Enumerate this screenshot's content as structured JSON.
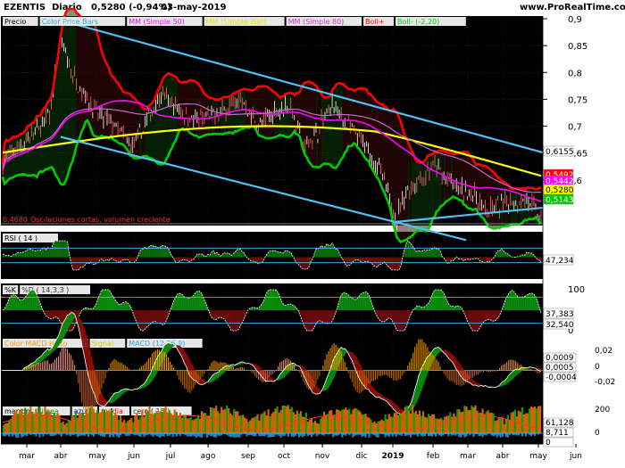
{
  "header": {
    "symbol": "EZENTIS",
    "period": "Diario",
    "price_change": "0,5280 (-0,94%)",
    "date": "03-may-2019",
    "site": "www.ProRealTime.com"
  },
  "price_panel": {
    "legend": [
      {
        "label": "Precio",
        "color": "#000000"
      },
      {
        "label": "Color Price Bars",
        "color": "#2ea8e0"
      },
      {
        "label": "MM (Simple 50)",
        "color": "#ff00ff"
      },
      {
        "label": "MM (Simple 200)",
        "color": "#e6e600"
      },
      {
        "label": "MM (Simple 80)",
        "color": "#cc33cc"
      },
      {
        "label": "Boll+",
        "color": "#ff0000"
      },
      {
        "label": "Boll- (-2,20)",
        "color": "#00cc00"
      }
    ],
    "y_ticks": [
      "0,9",
      "0,85",
      "0,8",
      "0,75",
      "0,7",
      "0,65",
      "0,6"
    ],
    "y_range": [
      0.515,
      0.905
    ],
    "value_boxes": [
      {
        "value": "0,6155",
        "bg": "#ffffff",
        "fg": "#000000",
        "v": 0.6155
      },
      {
        "value": "0,5492",
        "bg": "#ff0000",
        "fg": "#ffffff",
        "v": 0.5492
      },
      {
        "value": "0,5442",
        "bg": "#ff00ff",
        "fg": "#ffffff",
        "v": 0.5442
      },
      {
        "value": "0,5280",
        "bg": "#ffff00",
        "fg": "#000000",
        "v": 0.528
      },
      {
        "value": "0,5143",
        "bg": "#00cc00",
        "fg": "#ffffff",
        "v": 0.5143
      }
    ],
    "bottom_note": "0,4680",
    "bottom_caption": "Oscilaciones cortas, volumen creciente"
  },
  "rsi_panel": {
    "legend": [
      {
        "label": "RSI ( 14 )",
        "color": "#000000"
      }
    ],
    "value_box": {
      "value": "47,234",
      "bg": "#ffffff",
      "fg": "#000000"
    }
  },
  "stoch_panel": {
    "legend": [
      {
        "label": "%K",
        "color": "#000000"
      },
      {
        "label": "%D ( 14,3,3 )",
        "color": "#333333"
      }
    ],
    "y_ticks": [
      "100",
      "0"
    ],
    "value_boxes": [
      {
        "value": "37,383",
        "bg": "#ffffff",
        "fg": "#000000"
      },
      {
        "value": "32,540",
        "bg": "#ffffff",
        "fg": "#000000"
      }
    ]
  },
  "macd_panel": {
    "legend": [
      {
        "label": "Color MACD Histo",
        "color": "#ff9900"
      },
      {
        "label": "Signal",
        "color": "#cccc00"
      },
      {
        "label": "MACD (12,26,9)",
        "color": "#2ea8e0"
      }
    ],
    "y_ticks": [
      "0,02",
      "0",
      "-0,02"
    ],
    "value_boxes": [
      {
        "value": "0,0009",
        "bg": "#ffffff",
        "fg": "#000000"
      },
      {
        "value": "0,0005",
        "bg": "#ffffff",
        "fg": "#000000"
      },
      {
        "value": "-0,0004",
        "bg": "#ffffff",
        "fg": "#000000"
      }
    ]
  },
  "vol_panel": {
    "legend": [
      {
        "label": "marron",
        "color": "#000000"
      },
      {
        "label": "linea",
        "color": "#00aa00"
      },
      {
        "label": "azul",
        "color": "#0000cc"
      },
      {
        "label": "media",
        "color": "#ff0000"
      },
      {
        "label": "cero ( 15 )",
        "color": "#333333"
      }
    ],
    "y_ticks": [
      "200",
      "0"
    ],
    "value_boxes": [
      {
        "value": "61,128",
        "bg": "#ffffff",
        "fg": "#000000"
      },
      {
        "value": "8,711",
        "bg": "#ffffff",
        "fg": "#000000"
      },
      {
        "value": "0",
        "bg": "#ffffff",
        "fg": "#000000"
      }
    ]
  },
  "x_axis": {
    "months": [
      "mar",
      "abr",
      "may",
      "jun",
      "jul",
      "ago",
      "sep",
      "oct",
      "nov",
      "dic",
      "2019",
      "feb",
      "mar",
      "abr",
      "may",
      "jun"
    ]
  },
  "chart_data": {
    "type": "line",
    "x_labels": [
      "mar",
      "abr",
      "may",
      "jun",
      "jul",
      "ago",
      "sep",
      "oct",
      "nov",
      "dic",
      "2019",
      "feb",
      "mar",
      "abr",
      "may"
    ],
    "series": [
      {
        "name": "Precio",
        "values": [
          0.64,
          0.84,
          0.73,
          0.66,
          0.74,
          0.71,
          0.73,
          0.72,
          0.66,
          0.66,
          0.5,
          0.57,
          0.56,
          0.53,
          0.528
        ]
      },
      {
        "name": "MM (Simple 200)",
        "values": [
          0.655,
          0.66,
          0.66,
          0.66,
          0.68,
          0.69,
          0.7,
          0.7,
          0.69,
          0.685,
          0.675,
          0.66,
          0.645,
          0.63,
          0.615
        ]
      },
      {
        "name": "MM (Simple 50)",
        "values": [
          0.65,
          0.68,
          0.7,
          0.69,
          0.7,
          0.71,
          0.71,
          0.7,
          0.69,
          0.66,
          0.59,
          0.57,
          0.555,
          0.55,
          0.544
        ]
      }
    ],
    "ylim": [
      0.515,
      0.905
    ]
  },
  "colors": {
    "panel_bg": "#000000",
    "grid": "#333333",
    "channel": "#4fc3f7",
    "up": "#00cc00",
    "down": "#cc0000"
  }
}
